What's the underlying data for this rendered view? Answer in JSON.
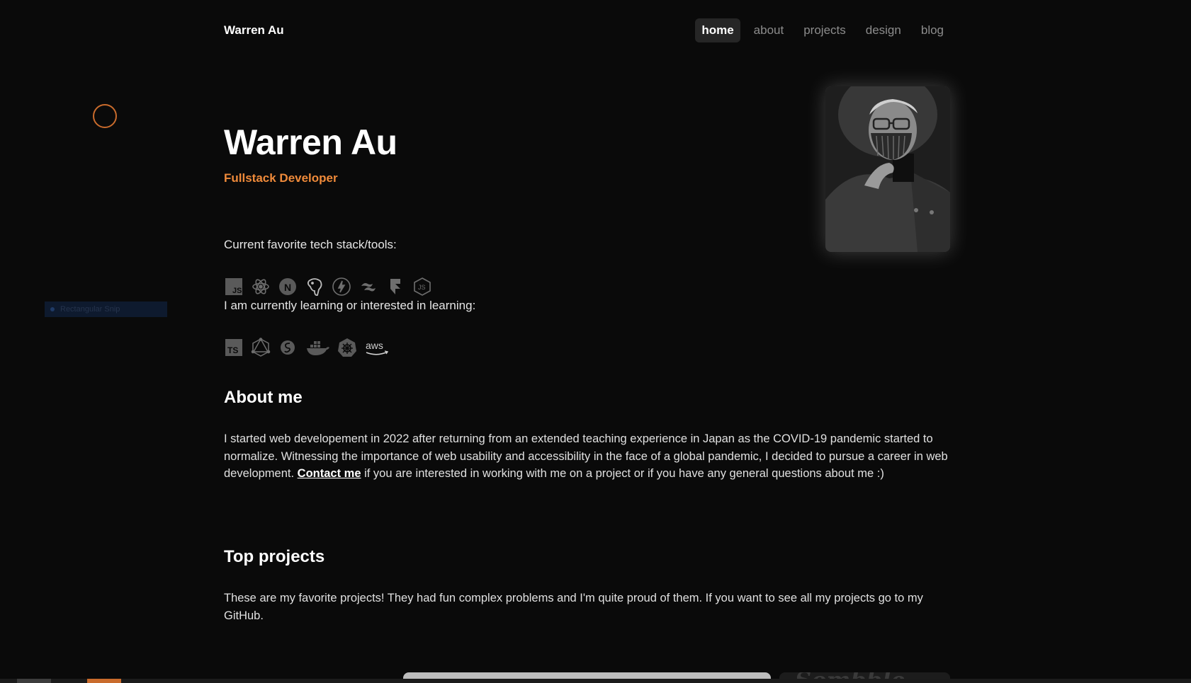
{
  "nav": {
    "brand": "Warren Au",
    "links": [
      {
        "label": "home",
        "active": true
      },
      {
        "label": "about",
        "active": false
      },
      {
        "label": "projects",
        "active": false
      },
      {
        "label": "design",
        "active": false
      },
      {
        "label": "blog",
        "active": false
      }
    ]
  },
  "overlay": {
    "snip_label": "Rectangular Snip"
  },
  "hero": {
    "name": "Warren Au",
    "role": "Fullstack Developer",
    "portrait_icon": "portrait-photo"
  },
  "stack": {
    "label": "Current favorite tech stack/tools:",
    "icons": [
      "javascript-icon",
      "react-icon",
      "nextjs-icon",
      "postgresql-icon",
      "supabase-icon",
      "tailwind-icon",
      "framer-icon",
      "nodejs-icon"
    ]
  },
  "learning": {
    "label": "I am currently learning or interested in learning:",
    "icons": [
      "typescript-icon",
      "graphql-icon",
      "sass-icon",
      "docker-icon",
      "kubernetes-icon",
      "aws-icon"
    ],
    "aws_text": "aws"
  },
  "about": {
    "heading": "About me",
    "text_before": "I started web developement in 2022 after returning from an extended teaching experience in Japan as the COVID-19 pandemic started to normalize. Witnessing the importance of web usability and accessibility in the face of a global pandemic, I decided to pursue a career in web development. ",
    "link": "Contact me",
    "text_after": " if you are interested in working with me on a project or if you have any general questions about me :)"
  },
  "projects": {
    "heading": "Top projects",
    "text": "These are my favorite projects! They had fun complex problems and I'm quite proud of them. If you want to see all my projects go to my GitHub.",
    "card2_peek": "Sombble"
  },
  "colors": {
    "background": "#0a0a0a",
    "accent": "#ef8a3a",
    "nav_active_bg": "#262626",
    "icon": "#6e6e6e"
  }
}
